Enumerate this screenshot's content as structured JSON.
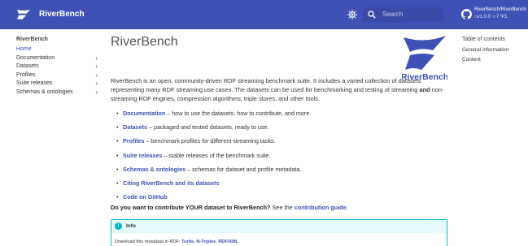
{
  "header": {
    "site_title": "RiverBench",
    "search_placeholder": "Search",
    "repo_name": "RiverBench/RiverBench",
    "repo_version": "v1.0.0",
    "repo_stars": "7",
    "repo_forks": "1",
    "accent_color": "#3f51b5"
  },
  "nav": {
    "title": "RiverBench",
    "items": [
      {
        "label": "Home",
        "active": true
      },
      {
        "label": "Documentation",
        "has_children": true
      },
      {
        "label": "Datasets",
        "has_children": true
      },
      {
        "label": "Profiles",
        "has_children": true
      },
      {
        "label": "Suite releases",
        "has_children": true
      },
      {
        "label": "Schemas & ontologies",
        "has_children": true
      }
    ]
  },
  "toc": {
    "title": "Table of contents",
    "items": [
      "General information",
      "Content"
    ]
  },
  "main": {
    "title": "RiverBench",
    "brand_logo_text": "RiverBench",
    "intro_pre": "RiverBench is an open, community-driven RDF streaming benchmark suite. It includes a varied collection of datasets representing many RDF streaming use cases. The datasets can be used for benchmarking and testing of streaming ",
    "intro_and": "and",
    "intro_post": " non-streaming RDF engines, compression algorithms, triple stores, and other tools.",
    "links": [
      {
        "label": "Documentation",
        "desc": " – how to use the datasets, how to contribute, and more."
      },
      {
        "label": "Datasets",
        "desc": " – packaged and tested datasets, ready to use."
      },
      {
        "label": "Profiles",
        "desc": " – benchmark profiles for different streaming tasks."
      },
      {
        "label": "Suite releases",
        "desc": " – stable releases of the benchmark suite."
      },
      {
        "label": "Schemas & ontologies",
        "desc": " – schemas for dataset and profile metadata."
      },
      {
        "label": "Citing RiverBench and its datasets",
        "desc": ""
      },
      {
        "label": "Code on GitHub",
        "desc": ""
      }
    ],
    "contrib_bold": "Do you want to contribute YOUR dataset to RiverBench?",
    "contrib_mid": " See the ",
    "contrib_link": "contribution guide",
    "contrib_end": ".",
    "admonition": {
      "title": "Info",
      "text": "Download this metadata in RDF: ",
      "links": [
        "Turtle",
        "N-Triples",
        "RDF/XML"
      ]
    }
  }
}
